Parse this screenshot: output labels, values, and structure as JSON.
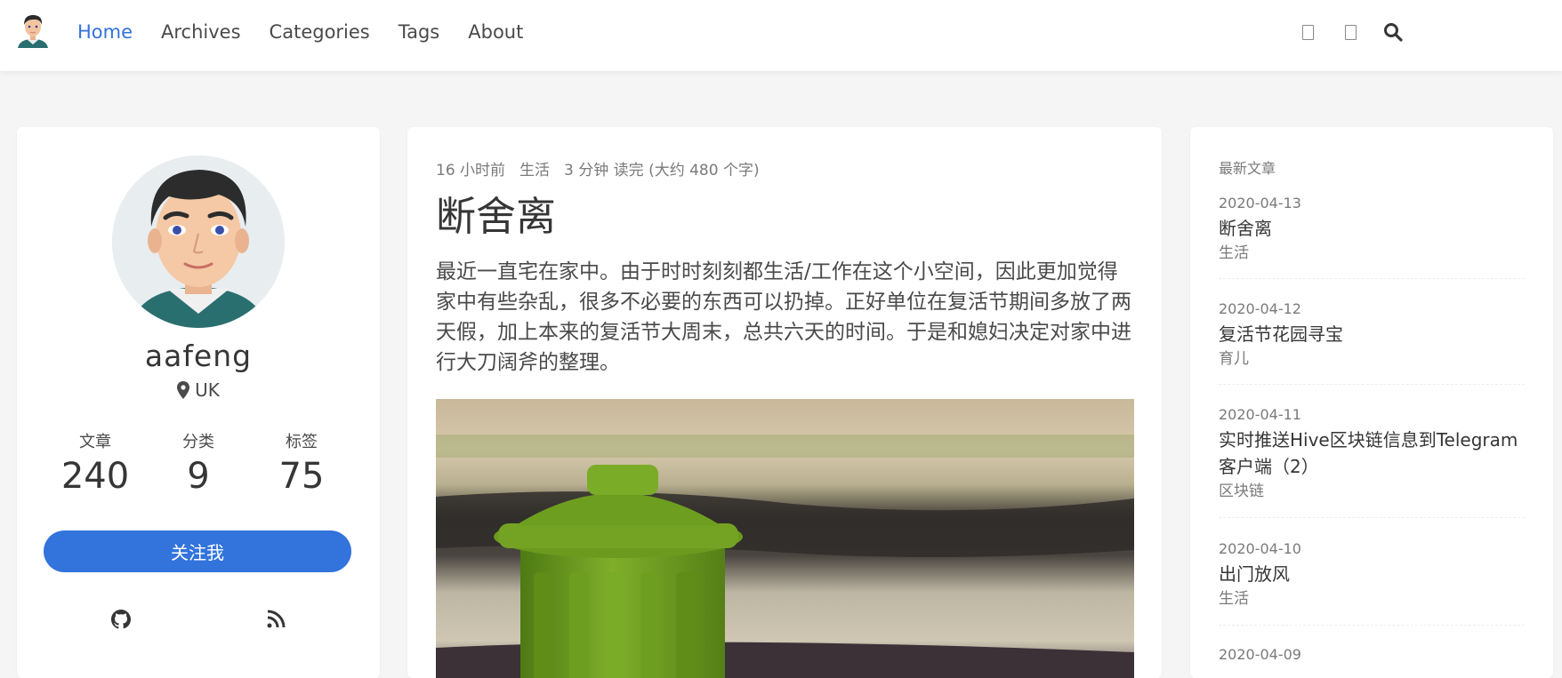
{
  "nav": {
    "links": [
      "Home",
      "Archives",
      "Categories",
      "Tags",
      "About"
    ],
    "active": "Home",
    "icons": [
      "translate-icon",
      "toc-icon",
      "search-icon"
    ]
  },
  "profile": {
    "name": "aafeng",
    "location": "UK",
    "stats": [
      {
        "label": "文章",
        "value": "240"
      },
      {
        "label": "分类",
        "value": "9"
      },
      {
        "label": "标签",
        "value": "75"
      }
    ],
    "follow_label": "关注我",
    "social_icons": [
      "github-icon",
      "rss-icon"
    ]
  },
  "article": {
    "time": "16 小时前",
    "category": "生活",
    "reading": "3 分钟 读完 (大约 480 个字)",
    "title": "断舍离",
    "excerpt": "最近一直宅在家中。由于时时刻刻都生活/工作在这个小空间，因此更加觉得家中有些杂乱，很多不必要的东西可以扔掉。正好单位在复活节期间多放了两天假，加上本来的复活节大周末，总共六天的时间。于是和媳妇决定对家中进行大刀阔斧的整理。"
  },
  "recent": {
    "heading": "最新文章",
    "posts": [
      {
        "date": "2020-04-13",
        "title": "断舍离",
        "category": "生活"
      },
      {
        "date": "2020-04-12",
        "title": "复活节花园寻宝",
        "category": "育儿"
      },
      {
        "date": "2020-04-11",
        "title": "实时推送Hive区块链信息到Telegram客户端（2）",
        "category": "区块链"
      },
      {
        "date": "2020-04-10",
        "title": "出门放风",
        "category": "生活"
      },
      {
        "date": "2020-04-09",
        "title": "",
        "category": ""
      }
    ]
  },
  "colors": {
    "accent": "#3273dc",
    "background": "#f5f5f5",
    "trash_can": "#6b9a1f"
  }
}
